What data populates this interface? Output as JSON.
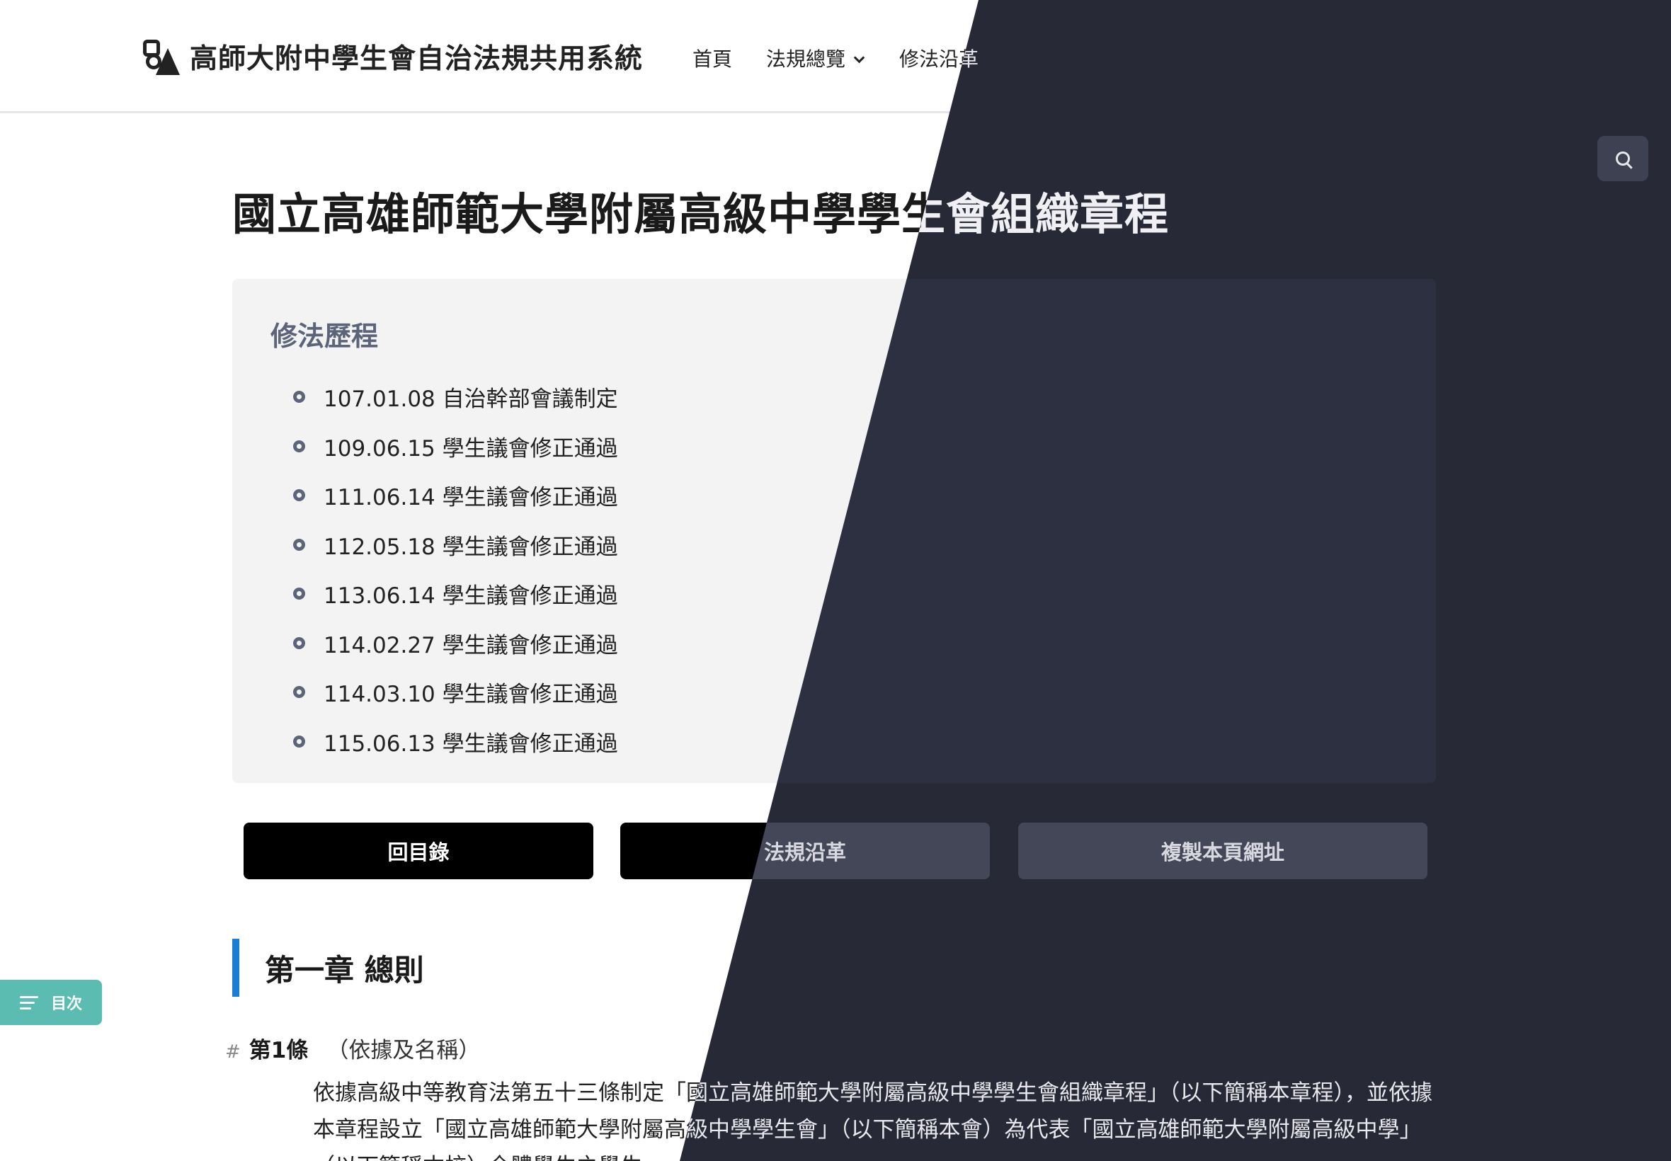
{
  "header": {
    "site_title": "高師大附中學生會自治法規共用系統",
    "nav": [
      {
        "label": "首頁"
      },
      {
        "label": "法規總覽"
      },
      {
        "label": "修法沿革"
      }
    ]
  },
  "page": {
    "title": "國立高雄師範大學附屬高級中學學生會組織章程"
  },
  "history": {
    "title": "修法歷程",
    "items": [
      "107.01.08 自治幹部會議制定",
      "109.06.15 學生議會修正通過",
      "111.06.14 學生議會修正通過",
      "112.05.18 學生議會修正通過",
      "113.06.14 學生議會修正通過",
      "114.02.27 學生議會修正通過",
      "114.03.10 學生議會修正通過",
      "115.06.13 學生議會修正通過"
    ]
  },
  "actions": {
    "back_label": "回目錄",
    "history_label": "法規沿革",
    "copy_label": "複製本頁網址"
  },
  "toc": {
    "label": "目次"
  },
  "content": {
    "chapter": "第一章 總則",
    "article_number": "第1條",
    "article_name": "（依據及名稱）",
    "article_text": "依據高級中等教育法第五十三條制定「國立高雄師範大學附屬高級中學學生會組織章程」（以下簡稱本章程），並依據本章程設立「國立高雄師範大學附屬高級中學學生會」（以下簡稱本會）為代表「國立高雄師範大學附屬高級中學」（以下簡稱本校）全體學生之學生"
  },
  "colors": {
    "dark_overlay": "#272a36",
    "accent_blue": "#1a7fd4",
    "toc_teal": "#5bbcb2",
    "history_title": "#5b6478"
  }
}
